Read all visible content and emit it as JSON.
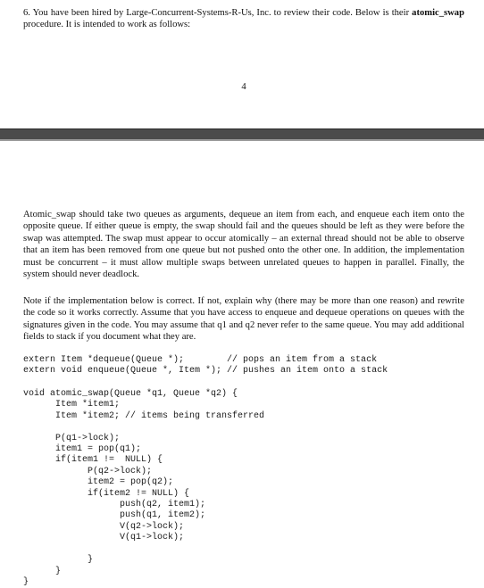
{
  "intro": {
    "number": "6.",
    "text_before": " You have been hired by Large-Concurrent-Systems-R-Us, Inc. to review their code. Below is their ",
    "procedure": "atomic_swap",
    "text_after": " procedure. It is intended to work as follows:"
  },
  "page_number": "4",
  "description": "Atomic_swap should take two queues as arguments, dequeue an item from each, and enqueue each item onto the opposite queue. If either queue is empty, the swap should fail and the queues should be left as they were before the swap was attempted. The swap must appear to occur atomically – an external thread should not be able to observe that an item has been removed from one queue but not pushed onto the other one. In addition, the implementation must be concurrent – it must allow multiple swaps between unrelated queues to happen in parallel. Finally, the system should never deadlock.",
  "instructions": "Note if the implementation below is correct. If not, explain why (there may be more than one reason) and rewrite the code so it works correctly. Assume that you have access to enqueue and dequeue operations on queues with the signatures given in the code. You may assume that q1 and q2 never refer to the same queue. You may add additional fields to stack if you document what they are.",
  "code_externs": "extern Item *dequeue(Queue *);        // pops an item from a stack\nextern void enqueue(Queue *, Item *); // pushes an item onto a stack",
  "code_main": "void atomic_swap(Queue *q1, Queue *q2) {\n      Item *item1;\n      Item *item2; // items being transferred\n\n      P(q1->lock);\n      item1 = pop(q1);\n      if(item1 !=  NULL) {\n            P(q2->lock);\n            item2 = pop(q2);\n            if(item2 != NULL) {\n                  push(q2, item1);\n                  push(q1, item2);\n                  V(q2->lock);\n                  V(q1->lock);\n\n            }\n      }\n}"
}
